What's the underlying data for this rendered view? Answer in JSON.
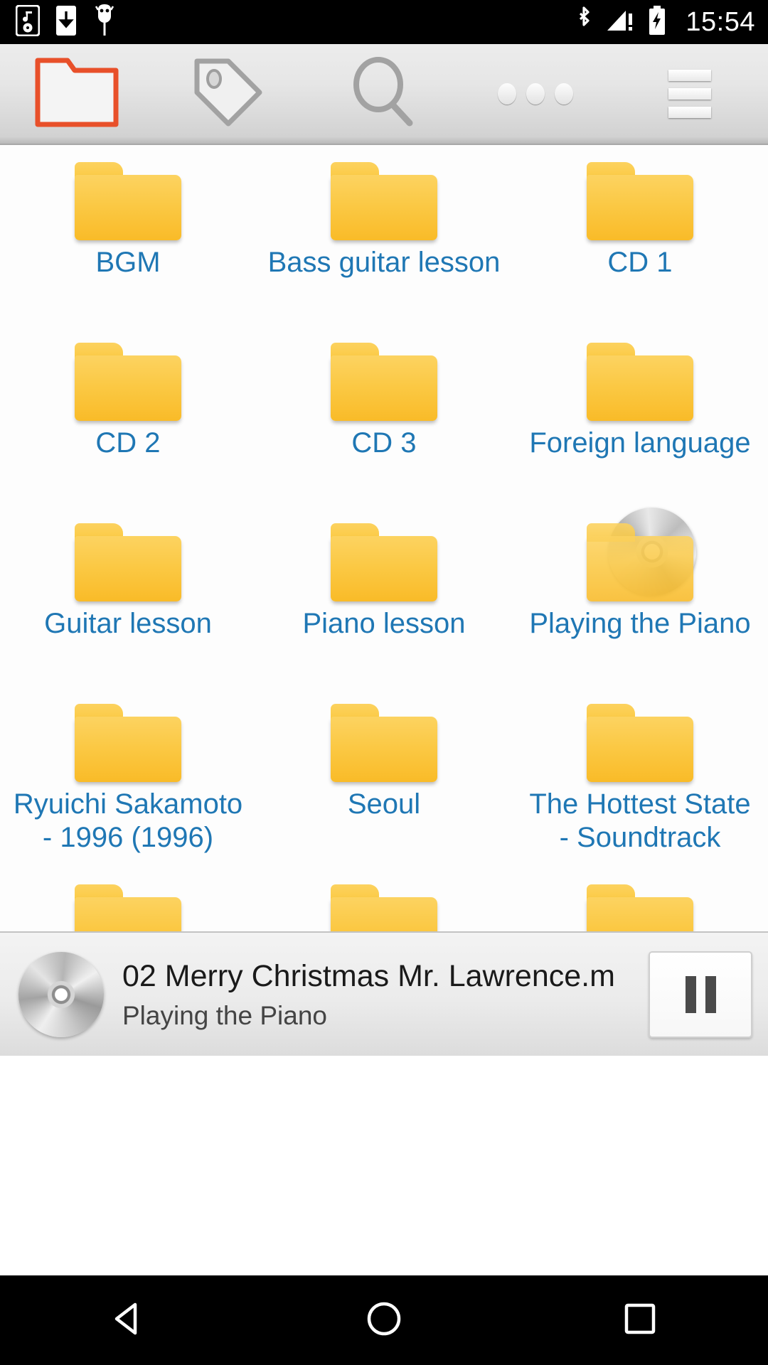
{
  "statusbar": {
    "time": "15:54",
    "left_icons": [
      "music-player-icon",
      "download-icon",
      "android-head-icon"
    ],
    "right_icons": [
      "bluetooth-icon",
      "signal-warning-icon",
      "battery-charging-icon"
    ]
  },
  "toolbar": {
    "items": [
      {
        "name": "folder-tab",
        "icon": "folder-icon",
        "selected": true,
        "color": "#e8502a"
      },
      {
        "name": "tag-tab",
        "icon": "tag-icon",
        "selected": false,
        "color": "#9a9a9a"
      },
      {
        "name": "search-tab",
        "icon": "search-icon",
        "selected": false,
        "color": "#9a9a9a"
      },
      {
        "name": "overflow-tab",
        "icon": "more-dots-icon",
        "selected": false,
        "color": "#9a9a9a"
      },
      {
        "name": "menu-tab",
        "icon": "hamburger-menu-icon",
        "selected": false,
        "color": "#9a9a9a"
      }
    ]
  },
  "grid": {
    "label_color": "#1f77b4",
    "items": [
      {
        "label": "BGM",
        "icon": "folder-icon"
      },
      {
        "label": "Bass guitar lesson",
        "icon": "folder-icon"
      },
      {
        "label": "CD 1",
        "icon": "folder-icon"
      },
      {
        "label": "CD 2",
        "icon": "folder-icon"
      },
      {
        "label": "CD 3",
        "icon": "folder-icon"
      },
      {
        "label": "Foreign language",
        "icon": "folder-icon"
      },
      {
        "label": "Guitar lesson",
        "icon": "folder-icon"
      },
      {
        "label": "Piano lesson",
        "icon": "folder-icon"
      },
      {
        "label": "Playing the Piano",
        "icon": "folder-cd-icon"
      },
      {
        "label": "Ryuichi Sakamoto - 1996 (1996)",
        "icon": "folder-icon"
      },
      {
        "label": "Seoul",
        "icon": "folder-icon"
      },
      {
        "label": "The Hottest State - Soundtrack",
        "icon": "folder-icon"
      },
      {
        "label": "",
        "icon": "folder-icon"
      },
      {
        "label": "",
        "icon": "folder-icon"
      },
      {
        "label": "",
        "icon": "folder-icon"
      }
    ]
  },
  "nowplaying": {
    "art": "album-art-cd-icon",
    "title": "02 Merry Christmas Mr. Lawrence.m",
    "subtitle": "Playing the Piano",
    "button_icon": "pause-icon"
  },
  "navbar": {
    "buttons": [
      {
        "name": "back-button",
        "icon": "back-triangle-icon"
      },
      {
        "name": "home-button",
        "icon": "home-circle-icon"
      },
      {
        "name": "recents-button",
        "icon": "recents-square-icon"
      }
    ]
  }
}
